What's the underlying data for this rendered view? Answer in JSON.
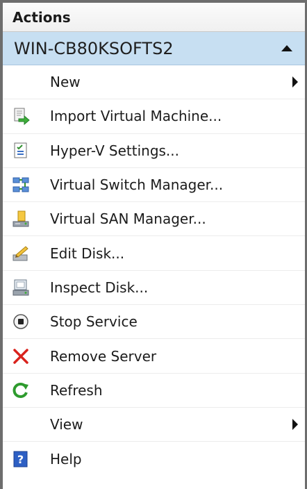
{
  "pane": {
    "title": "Actions"
  },
  "group": {
    "title": "WIN-CB80KSOFTS2"
  },
  "items": [
    {
      "label": "New",
      "icon": "none",
      "submenu": true
    },
    {
      "label": "Import Virtual Machine...",
      "icon": "import-vm-icon"
    },
    {
      "label": "Hyper-V Settings...",
      "icon": "hyperv-settings-icon"
    },
    {
      "label": "Virtual Switch Manager...",
      "icon": "virtual-switch-icon"
    },
    {
      "label": "Virtual SAN Manager...",
      "icon": "virtual-san-icon"
    },
    {
      "label": "Edit Disk...",
      "icon": "edit-disk-icon"
    },
    {
      "label": "Inspect Disk...",
      "icon": "inspect-disk-icon"
    },
    {
      "label": "Stop Service",
      "icon": "stop-service-icon"
    },
    {
      "label": "Remove Server",
      "icon": "remove-server-icon"
    },
    {
      "label": "Refresh",
      "icon": "refresh-icon"
    },
    {
      "label": "View",
      "icon": "none",
      "submenu": true
    },
    {
      "label": "Help",
      "icon": "help-icon"
    }
  ],
  "colors": {
    "group_bg": "#c7dff2",
    "remove_x": "#d9221c",
    "refresh_green": "#2e9b2e",
    "help_blue": "#2d5fc4"
  }
}
